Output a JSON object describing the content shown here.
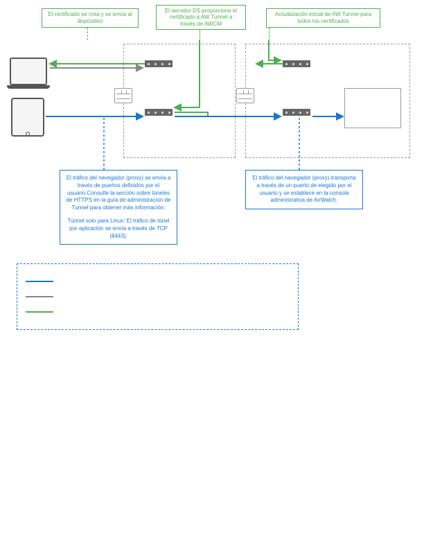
{
  "topBoxes": {
    "cert_created": "El certificado se crea y se envía al dispositivo",
    "ds_server": "El servidor DS proporcione el certificado  a AW Tunnel a través de AWCM",
    "aw_update": "Actualización inicial de AW Tunnel para todos los certificados"
  },
  "bottomBoxes": {
    "left_p1": "El tráfico del navegador (proxy) se envía a través de puertos definidos por el usuario.Consulte la sección sobre túneles de HTTPS  en la guía de administración de Tunnel para obtener más información.",
    "left_p2": "Tunnel solo para Linux: El tráfico de túnel por aplicación se envía a través de TCP (8443).",
    "right_p": "El tráfico del navegador (proxy) transporta a través de un puerto de elegido por el usuario y se establece en la consola administrativa de AirWatch."
  },
  "legend": {
    "blue": "",
    "gray": "",
    "green": ""
  },
  "colors": {
    "green": "#4caf50",
    "blue": "#1976d2",
    "gray": "#888"
  }
}
